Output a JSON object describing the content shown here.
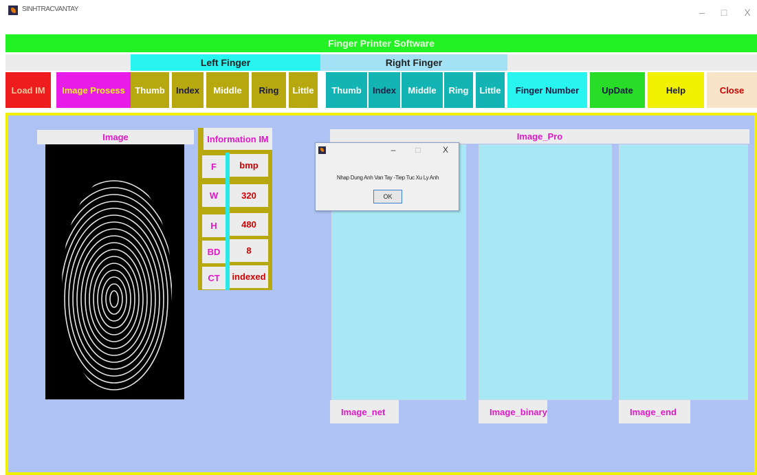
{
  "window": {
    "title": "SINHTRACVANTAY",
    "controls": {
      "minimize": "–",
      "maximize": "□",
      "close": "X"
    }
  },
  "header": {
    "title": "Finger Printer Software"
  },
  "groups": {
    "left": "Left Finger",
    "right": "Right Finger"
  },
  "toolbar": {
    "load_im": "Load IM",
    "image_process": "Image Prosess",
    "left_thumb": "Thumb",
    "left_index": "Index",
    "left_middle": "Middle",
    "left_ring": "Ring",
    "left_little": "Little",
    "right_thumb": "Thumb",
    "right_index": "Index",
    "right_middle": "Middle",
    "right_ring": "Ring",
    "right_little": "Little",
    "finger_number": "Finger Number",
    "update": "UpDate",
    "help": "Help",
    "close": "Close"
  },
  "image_panel": {
    "title": "Image"
  },
  "information": {
    "title": "Information IM",
    "rows": [
      {
        "key": "F",
        "value": "bmp"
      },
      {
        "key": "W",
        "value": "320"
      },
      {
        "key": "H",
        "value": "480"
      },
      {
        "key": "BD",
        "value": "8"
      },
      {
        "key": "CT",
        "value": "indexed"
      }
    ]
  },
  "image_pro": {
    "title": "Image_Pro",
    "labels": {
      "net": "Image_net",
      "binary": "Image_binary",
      "end": "Image_end"
    }
  },
  "dialog": {
    "message": "Nhap Dung Anh Van Tay -Tiep Tuc Xu Ly Anh",
    "ok": "OK",
    "controls": {
      "minimize": "–",
      "maximize": "□",
      "close": "X"
    }
  },
  "colors": {
    "header_green": "#22f224",
    "load_red": "#ee1c1c",
    "process_magenta": "#e81ce8",
    "left_olive": "#b8a810",
    "right_teal": "#12b4b4",
    "finger_number_cyan": "#28f4f0",
    "update_green": "#28dc28",
    "help_yellow": "#f0f000",
    "close_peach": "#f8e4c8",
    "panel_blue": "#aec2f4",
    "image_box": "#a8e8f4"
  }
}
